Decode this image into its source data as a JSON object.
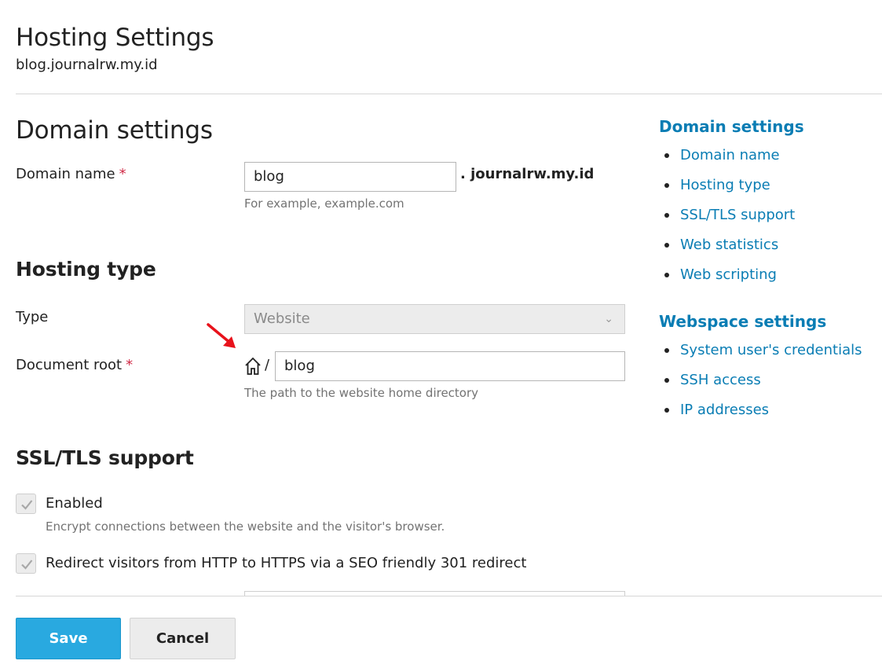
{
  "header": {
    "title": "Hosting Settings",
    "subtitle": "blog.journalrw.my.id"
  },
  "domain_settings": {
    "title": "Domain settings",
    "domain_name": {
      "label": "Domain name",
      "required_mark": "*",
      "value": "blog",
      "suffix": ". journalrw.my.id",
      "hint": "For example, example.com"
    }
  },
  "hosting_type": {
    "title": "Hosting type",
    "type": {
      "label": "Type",
      "selected": "Website"
    },
    "document_root": {
      "label": "Document root",
      "required_mark": "*",
      "prefix": "/",
      "value": "blog",
      "hint": "The path to the website home directory"
    }
  },
  "ssl_tls": {
    "title": "SSL/TLS support",
    "enabled": {
      "label": "Enabled",
      "checked": true,
      "hint": "Encrypt connections between the website and the visitor's browser."
    },
    "redirect": {
      "label": "Redirect visitors from HTTP to HTTPS via a SEO friendly 301 redirect",
      "checked": true
    }
  },
  "sidebar": {
    "domain_heading": "Domain settings",
    "domain_links": [
      "Domain name",
      "Hosting type",
      "SSL/TLS support",
      "Web statistics",
      "Web scripting"
    ],
    "webspace_heading": "Webspace settings",
    "webspace_links": [
      "System user's credentials",
      "SSH access",
      "IP addresses"
    ]
  },
  "footer": {
    "save_label": "Save",
    "cancel_label": "Cancel"
  },
  "colors": {
    "link": "#0a7db4",
    "primary_button": "#29a9e0",
    "required": "#d02b47",
    "annotation_arrow": "#e8121b"
  }
}
